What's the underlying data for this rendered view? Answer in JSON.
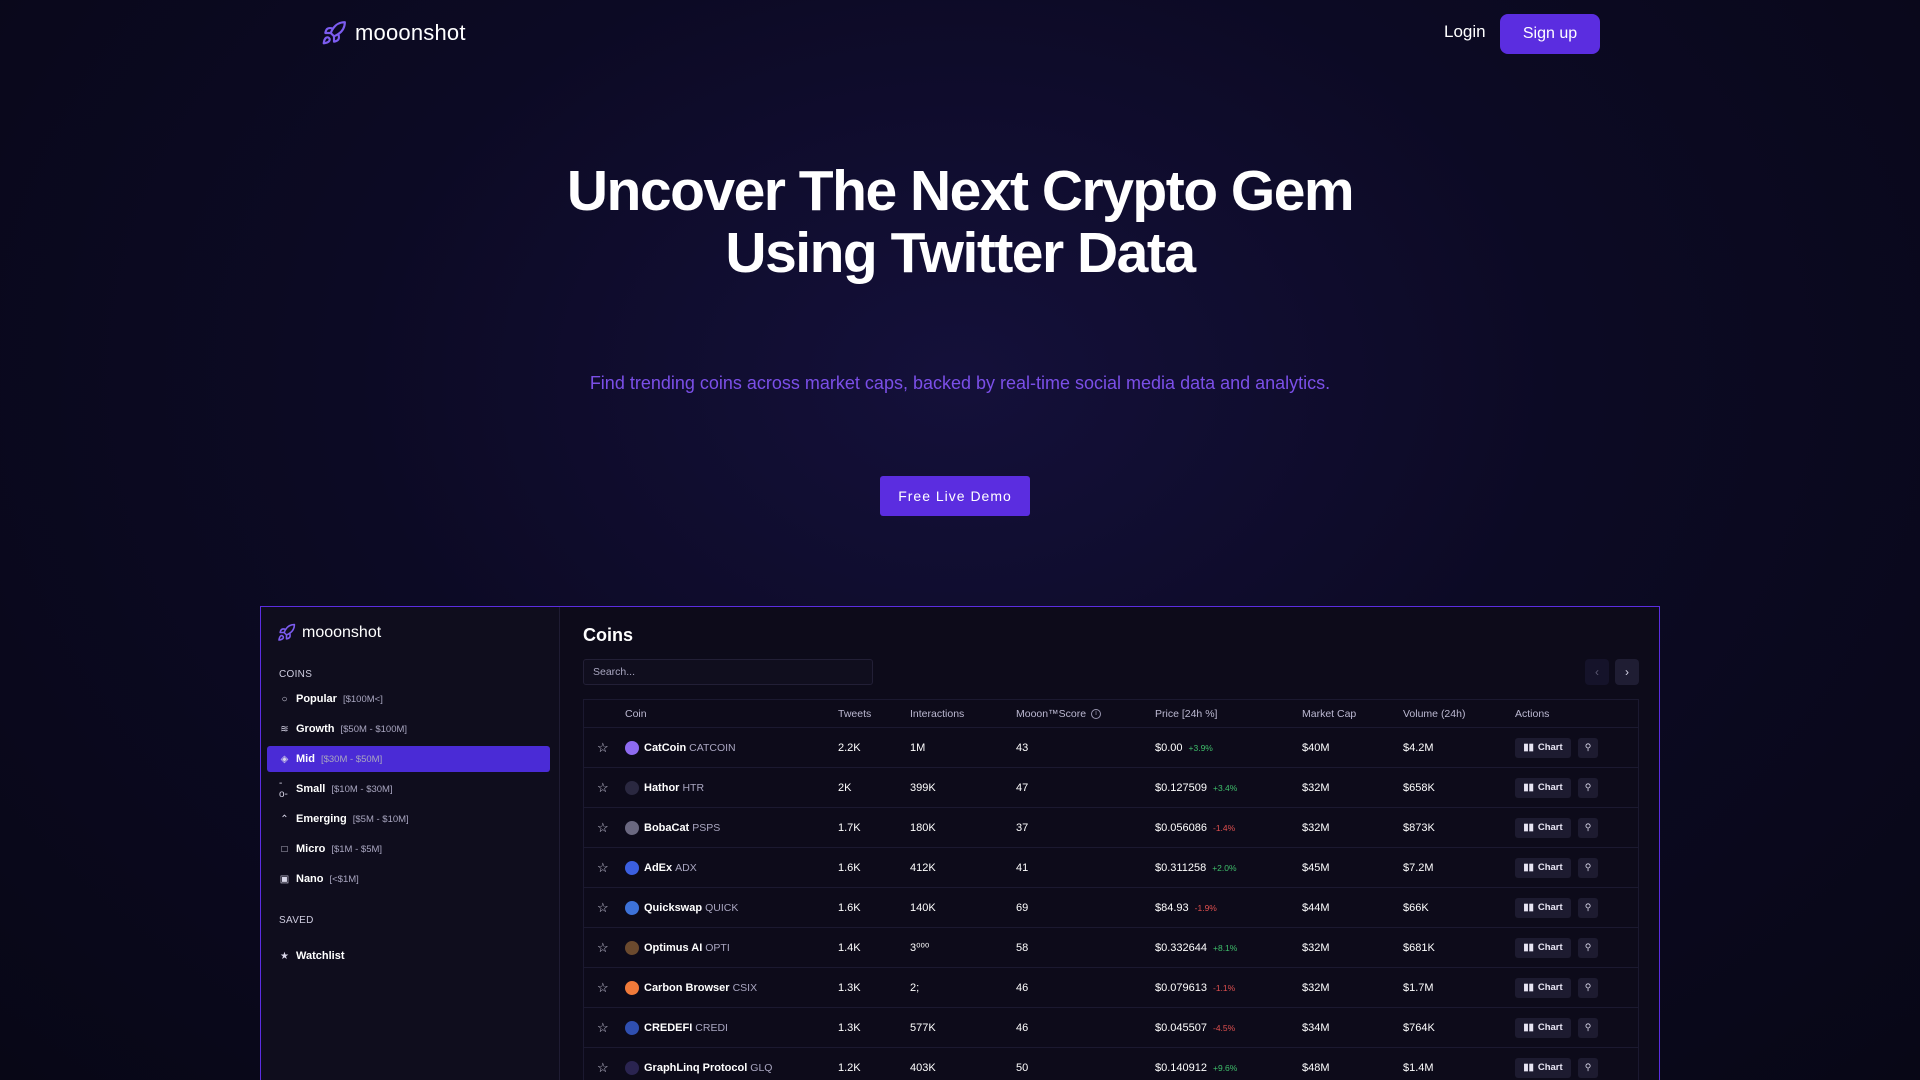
{
  "nav": {
    "brand": "mooonshot",
    "login_label": "Login",
    "signup_label": "Sign up"
  },
  "hero": {
    "title_line1": "Uncover The Next Crypto Gem",
    "title_line2": "Using Twitter Data",
    "subtitle": "Find trending coins across market caps, backed by real-time social media data and analytics.",
    "cta_label": "Free Live Demo"
  },
  "app": {
    "brand": "mooonshot",
    "sidebar": {
      "coins_heading": "COINS",
      "items": [
        {
          "label": "Popular",
          "range": "[$100M<]",
          "icon": "circle-icon"
        },
        {
          "label": "Growth",
          "range": "[$50M - $100M]",
          "icon": "layers-icon"
        },
        {
          "label": "Mid",
          "range": "[$30M - $50M]",
          "icon": "diamond-icon"
        },
        {
          "label": "Small",
          "range": "[$10M - $30M]",
          "icon": "commit-icon"
        },
        {
          "label": "Emerging",
          "range": "[$5M - $10M]",
          "icon": "chevrons-up-icon"
        },
        {
          "label": "Micro",
          "range": "[$1M - $5M]",
          "icon": "square-icon"
        },
        {
          "label": "Nano",
          "range": "[<$1M]",
          "icon": "dot-square-icon"
        }
      ],
      "active_index": 2,
      "saved_heading": "SAVED",
      "saved_items": [
        {
          "label": "Watchlist",
          "icon": "star-icon"
        }
      ]
    },
    "main": {
      "title": "Coins",
      "search_placeholder": "Search...",
      "columns": [
        "Coin",
        "Tweets",
        "Interactions",
        "Mooon™Score",
        "Price [24h %]",
        "Market Cap",
        "Volume (24h)",
        "Actions"
      ],
      "chart_label": "Chart",
      "rows": [
        {
          "name": "CatCoin",
          "symbol": "CATCOIN",
          "icon_color": "#8e6bf0",
          "tweets": "2.2K",
          "interactions": "1M",
          "score": "43",
          "price": "$0.00",
          "change": "+3.9%",
          "dir": "up",
          "mcap": "$40M",
          "volume": "$4.2M"
        },
        {
          "name": "Hathor",
          "symbol": "HTR",
          "icon_color": "#2a2840",
          "tweets": "2K",
          "interactions": "399K",
          "score": "47",
          "price": "$0.127509",
          "change": "+3.4%",
          "dir": "up",
          "mcap": "$32M",
          "volume": "$658K"
        },
        {
          "name": "BobaCat",
          "symbol": "PSPS",
          "icon_color": "#6a6880",
          "tweets": "1.7K",
          "interactions": "180K",
          "score": "37",
          "price": "$0.056086",
          "change": "-1.4%",
          "dir": "down",
          "mcap": "$32M",
          "volume": "$873K"
        },
        {
          "name": "AdEx",
          "symbol": "ADX",
          "icon_color": "#3b5fe0",
          "tweets": "1.6K",
          "interactions": "412K",
          "score": "41",
          "price": "$0.311258",
          "change": "+2.0%",
          "dir": "up",
          "mcap": "$45M",
          "volume": "$7.2M"
        },
        {
          "name": "Quickswap",
          "symbol": "QUICK",
          "icon_color": "#3d72d8",
          "tweets": "1.6K",
          "interactions": "140K",
          "score": "69",
          "price": "$84.93",
          "change": "-1.9%",
          "dir": "down",
          "mcap": "$44M",
          "volume": "$66K"
        },
        {
          "name": "Optimus AI",
          "symbol": "OPTI",
          "icon_color": "#6b4a2e",
          "tweets": "1.4K",
          "interactions": "3⁰⁰⁰",
          "score": "58",
          "price": "$0.332644",
          "change": "+8.1%",
          "dir": "up",
          "mcap": "$32M",
          "volume": "$681K"
        },
        {
          "name": "Carbon Browser",
          "symbol": "CSIX",
          "icon_color": "#f07a3a",
          "tweets": "1.3K",
          "interactions": "2;",
          "score": "46",
          "price": "$0.079613",
          "change": "-1.1%",
          "dir": "down",
          "mcap": "$32M",
          "volume": "$1.7M"
        },
        {
          "name": "CREDEFI",
          "symbol": "CREDI",
          "icon_color": "#2f4fb0",
          "tweets": "1.3K",
          "interactions": "577K",
          "score": "46",
          "price": "$0.045507",
          "change": "-4.5%",
          "dir": "down",
          "mcap": "$34M",
          "volume": "$764K"
        },
        {
          "name": "GraphLinq Protocol",
          "symbol": "GLQ",
          "icon_color": "#2a2450",
          "tweets": "1.2K",
          "interactions": "403K",
          "score": "50",
          "price": "$0.140912",
          "change": "+9.6%",
          "dir": "up",
          "mcap": "$48M",
          "volume": "$1.4M"
        }
      ]
    }
  },
  "colors": {
    "accent": "#5b2de0",
    "subtitle": "#7b4fe8",
    "up": "#3fbf6b",
    "down": "#e0504f"
  }
}
